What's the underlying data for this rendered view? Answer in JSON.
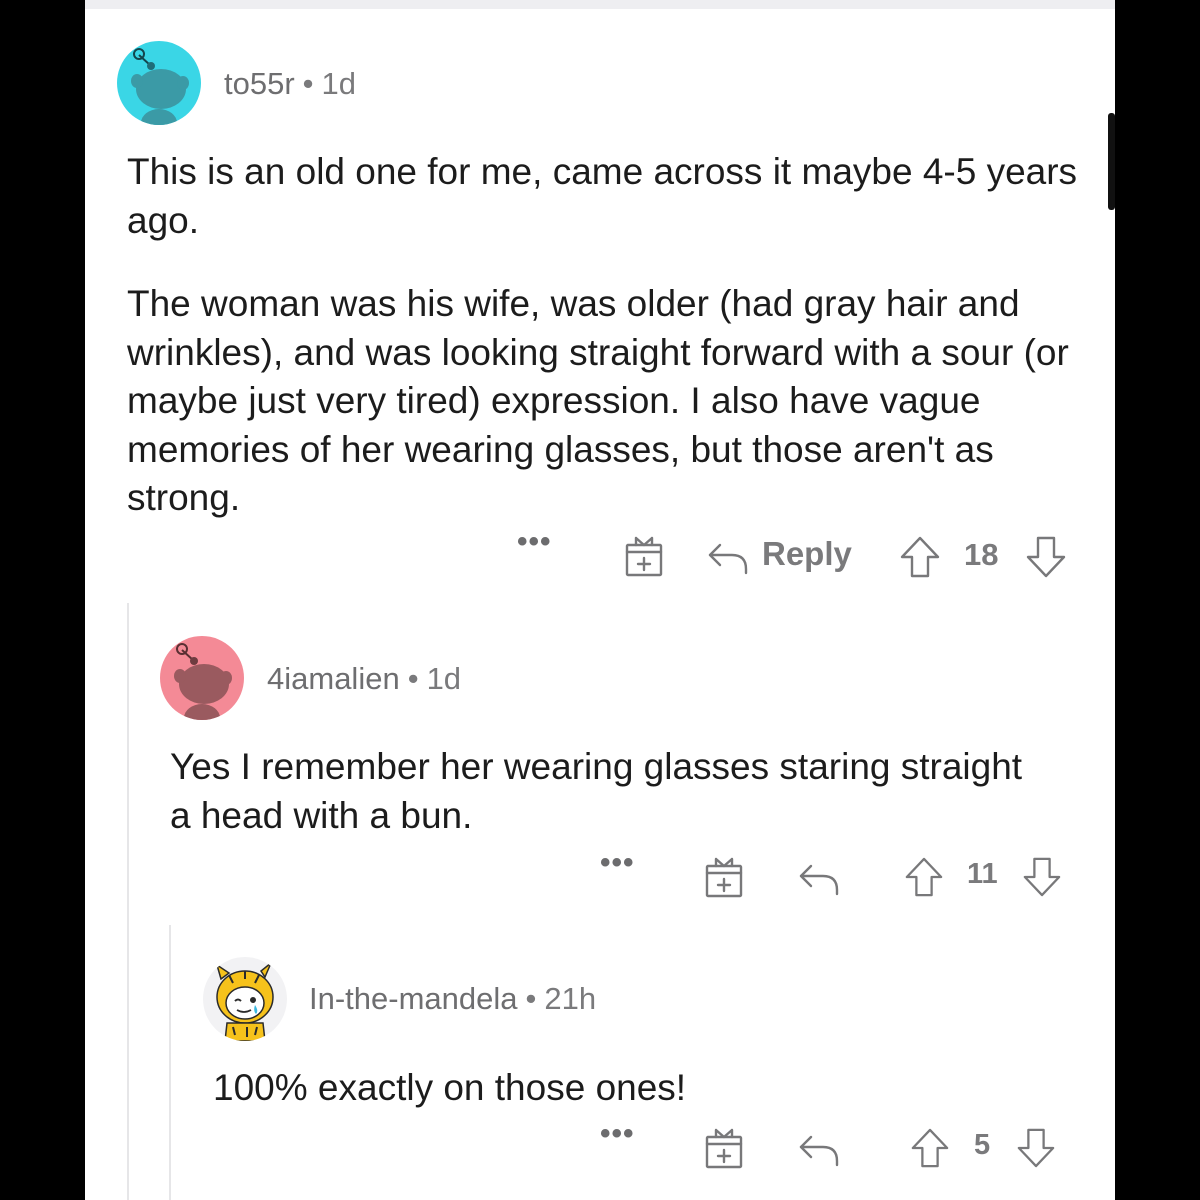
{
  "comments": [
    {
      "username": "to55r",
      "separator": "•",
      "age": "1d",
      "avatar_color": "#3ad6e6",
      "paragraphs": [
        "This is an old one for me, came across it maybe 4-5 years ago.",
        "The woman was his wife, was older (had gray hair and wrinkles), and was looking straight forward with a sour (or maybe just very tired) expression. I also have vague memories of her wearing glasses, but those aren't as strong."
      ],
      "actions": {
        "more": "•••",
        "reply_label": "Reply",
        "score": "18"
      }
    },
    {
      "username": "4iamalien",
      "separator": "•",
      "age": "1d",
      "avatar_color": "#f48a96",
      "paragraphs": [
        "Yes I remember her wearing glasses staring straight a head with a bun."
      ],
      "actions": {
        "more": "•••",
        "score": "11"
      }
    },
    {
      "username": "In-the-mandela",
      "separator": "•",
      "age": "21h",
      "avatar_color": "#f6c21b",
      "paragraphs": [
        "100% exactly on those ones!"
      ],
      "actions": {
        "more": "•••",
        "score": "5"
      }
    }
  ],
  "icons": {
    "award": "gift-box-plus-icon",
    "reply": "reply-arrow-icon",
    "upvote": "upvote-arrow-icon",
    "downvote": "downvote-arrow-icon"
  }
}
